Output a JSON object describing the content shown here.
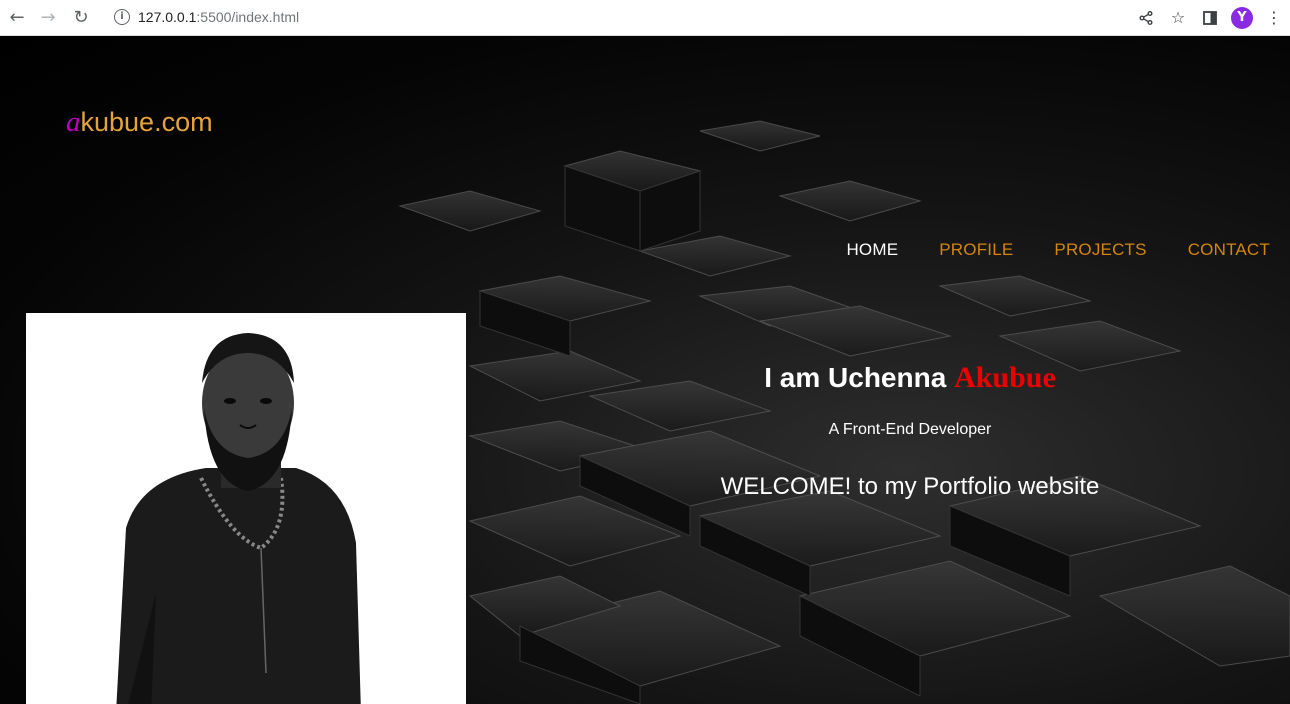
{
  "browser": {
    "url_host": "127.0.0.1",
    "url_path": ":5500/index.html",
    "profile_initial": "Y"
  },
  "site": {
    "logo_accent": "a",
    "logo_rest": "kubue.com",
    "nav": [
      {
        "label": "HOME"
      },
      {
        "label": "PROFILE"
      },
      {
        "label": "PROJECTS"
      },
      {
        "label": "CONTACT"
      }
    ],
    "intro": {
      "greeting": "I am Uchenna",
      "surname": "Akubue",
      "role": "A Front-End Developer",
      "welcome": "WELCOME! to my Portfolio website"
    }
  },
  "colors": {
    "accent_orange": "#d4850d",
    "logo_magenta": "#c000c0",
    "surname_red": "#ee0000"
  }
}
